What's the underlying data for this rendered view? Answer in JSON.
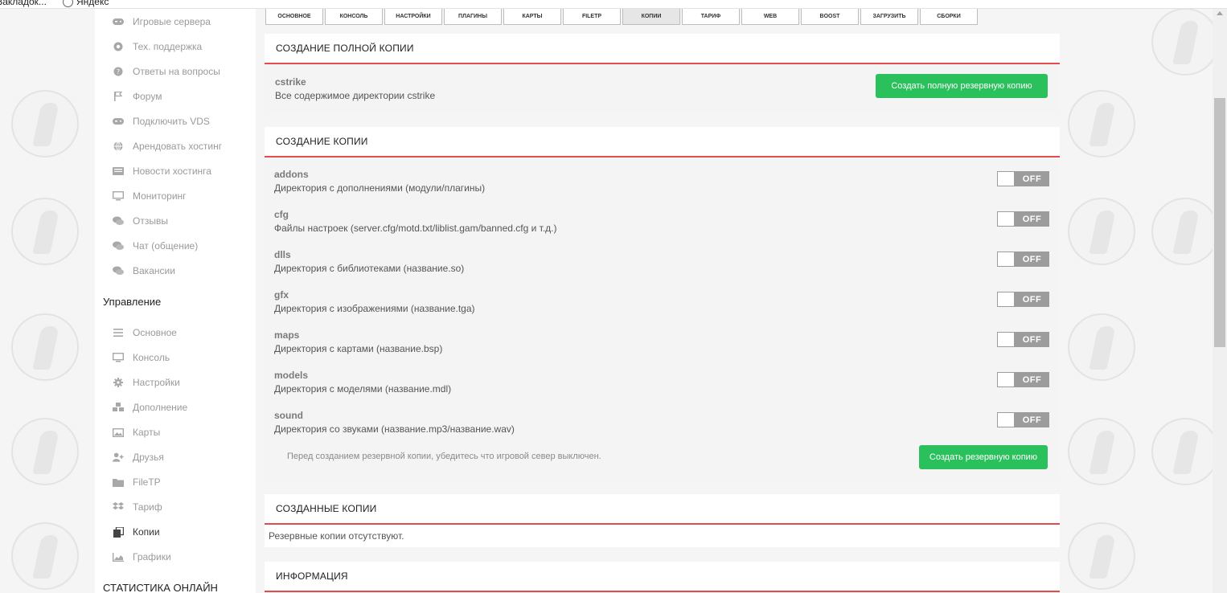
{
  "bookmarks": {
    "item1": "Закладок...",
    "item2": "Яндекс"
  },
  "sidebar": {
    "items_top": [
      {
        "label": "Игровые сервера",
        "icon": "gamepad-icon"
      },
      {
        "label": "Тех. поддержка",
        "icon": "lifebuoy-icon"
      },
      {
        "label": "Ответы на вопросы",
        "icon": "question-icon"
      },
      {
        "label": "Форум",
        "icon": "flag-icon"
      },
      {
        "label": "Подключить VDS",
        "icon": "gamepad-icon"
      },
      {
        "label": "Арендовать хостинг",
        "icon": "globe-icon"
      },
      {
        "label": "Новости хостинга",
        "icon": "news-icon"
      },
      {
        "label": "Мониторинг",
        "icon": "monitor-icon"
      },
      {
        "label": "Отзывы",
        "icon": "comments-icon"
      },
      {
        "label": "Чат (общение)",
        "icon": "comments-icon"
      },
      {
        "label": "Вакансии",
        "icon": "comments-icon"
      }
    ],
    "section_manage": "Управление",
    "items_manage": [
      {
        "label": "Основное",
        "icon": "list-icon"
      },
      {
        "label": "Консоль",
        "icon": "monitor-icon"
      },
      {
        "label": "Настройки",
        "icon": "gear-icon"
      },
      {
        "label": "Дополнение",
        "icon": "cubes-icon"
      },
      {
        "label": "Карты",
        "icon": "image-icon"
      },
      {
        "label": "Друзья",
        "icon": "user-plus-icon"
      },
      {
        "label": "FileTP",
        "icon": "folder-icon"
      },
      {
        "label": "Тариф",
        "icon": "dropbox-icon"
      },
      {
        "label": "Копии",
        "icon": "copy-icon"
      },
      {
        "label": "Графики",
        "icon": "chart-icon"
      }
    ],
    "section_stats": "СТАТИСТИКА ОНЛАЙН"
  },
  "tabs": [
    "ОСНОВНОЕ",
    "КОНСОЛЬ",
    "НАСТРОЙКИ",
    "ПЛАГИНЫ",
    "КАРТЫ",
    "FILETP",
    "КОПИИ",
    "ТАРИФ",
    "WEB",
    "BOOST",
    "ЗАГРУЗИТЬ",
    "СБОРКИ"
  ],
  "active_tab": "КОПИИ",
  "full_copy": {
    "title": "СОЗДАНИЕ ПОЛНОЙ КОПИИ",
    "name": "cstrike",
    "desc": "Все содержимое директории cstrike",
    "button": "Создать полную резервную копию"
  },
  "copy": {
    "title": "СОЗДАНИЕ КОПИИ",
    "options": [
      {
        "name": "addons",
        "desc": "Директория с дополнениями (модули/плагины)",
        "state": "OFF"
      },
      {
        "name": "cfg",
        "desc": "Файлы настроек (server.cfg/motd.txt/liblist.gam/banned.cfg и т.д.)",
        "state": "OFF"
      },
      {
        "name": "dlls",
        "desc": "Директория с библиотеками (название.so)",
        "state": "OFF"
      },
      {
        "name": "gfx",
        "desc": "Директория с изображениями (название.tga)",
        "state": "OFF"
      },
      {
        "name": "maps",
        "desc": "Директория с картами (название.bsp)",
        "state": "OFF"
      },
      {
        "name": "models",
        "desc": "Директория с моделями (название.mdl)",
        "state": "OFF"
      },
      {
        "name": "sound",
        "desc": "Директория со звуками (название.mp3/название.wav)",
        "state": "OFF"
      }
    ],
    "note": "Перед созданием резервной копии, убедитесь что игровой север выключен.",
    "button": "Создать резервную копию"
  },
  "created": {
    "title": "СОЗДАННЫЕ КОПИИ",
    "empty": "Резервные копии отсутствуют."
  },
  "info": {
    "title": "ИНФОРМАЦИЯ"
  },
  "colors": {
    "accent_red": "#e24c4c",
    "button_green": "#2ac05c",
    "toggle_off": "#9c9c9c"
  }
}
